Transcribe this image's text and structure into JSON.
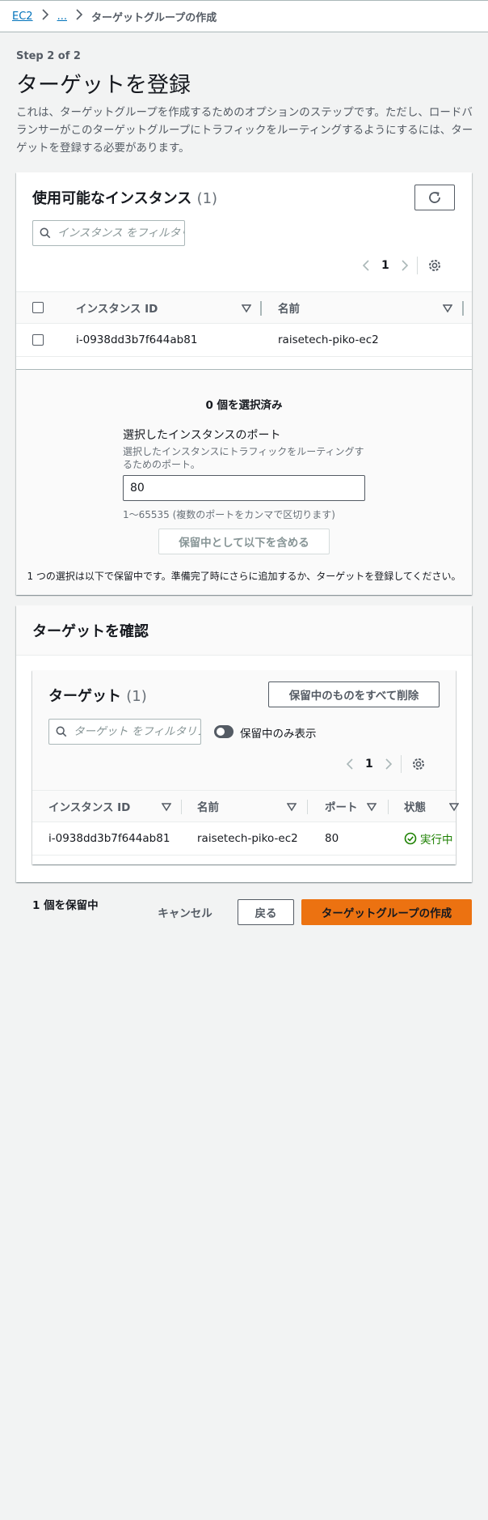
{
  "breadcrumb": {
    "root": "EC2",
    "ellipsis": "...",
    "current": "ターゲットグループの作成"
  },
  "header": {
    "step": "Step 2 of 2",
    "title": "ターゲットを登録",
    "description": "これは、ターゲットグループを作成するためのオプションのステップです。ただし、ロードバランサーがこのターゲットグループにトラフィックをルーティングするようにするには、ターゲットを登録する必要があります。"
  },
  "available": {
    "title": "使用可能なインスタンス",
    "count": "(1)",
    "search_placeholder": "インスタンス をフィルタリング",
    "page": "1",
    "columns": {
      "instance_id": "インスタンス ID",
      "name": "名前"
    },
    "rows": [
      {
        "instance_id": "i-0938dd3b7f644ab81",
        "name": "raisetech-piko-ec2"
      }
    ]
  },
  "selection": {
    "selected_count": "0 個を選択済み",
    "port_label": "選択したインスタンスのポート",
    "port_desc": "選択したインスタンスにトラフィックをルーティングするためのポート。",
    "port_value": "80",
    "port_hint": "1〜65535 (複数のポートをカンマで区切ります)",
    "include_button": "保留中として以下を含める",
    "pending_notice": "1 つの選択は以下で保留中です。準備完了時にさらに追加するか、ターゲットを登録してください。"
  },
  "review": {
    "title": "ターゲットを確認",
    "targets_title": "ターゲット",
    "targets_count": "(1)",
    "remove_all_button": "保留中のものをすべて削除",
    "search_placeholder": "ターゲット をフィルタリング",
    "toggle_label": "保留中のみ表示",
    "page": "1",
    "columns": {
      "instance_id": "インスタンス ID",
      "name": "名前",
      "port": "ポート",
      "status": "状態"
    },
    "rows": [
      {
        "instance_id": "i-0938dd3b7f644ab81",
        "name": "raisetech-piko-ec2",
        "port": "80",
        "status": "実行中"
      }
    ]
  },
  "footer": {
    "pending": "1 個を保留中",
    "cancel": "キャンセル",
    "back": "戻る",
    "create": "ターゲットグループの作成"
  },
  "colors": {
    "accent": "#ec7211",
    "link": "#0073bb",
    "success": "#1d8102"
  }
}
